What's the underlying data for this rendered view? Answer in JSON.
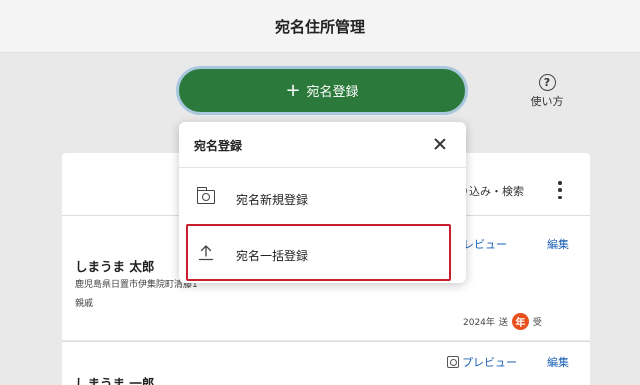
{
  "header": {
    "title": "宛名住所管理"
  },
  "register_button": {
    "plus": "+",
    "label": "宛名登録"
  },
  "help": {
    "icon_glyph": "?",
    "label": "使い方"
  },
  "toolbar": {
    "filter_label": "り込み・検索"
  },
  "dropdown": {
    "title": "宛名登録",
    "items": [
      {
        "label": "宛名新規登録",
        "icon": "folder-person-icon"
      },
      {
        "label": "宛名一括登録",
        "icon": "upload-icon"
      }
    ]
  },
  "entries": [
    {
      "name": "しまうま 太郎",
      "address": "鹿児島県日置市伊集院町清藤1",
      "relation": "親戚",
      "preview": "プレビュー",
      "edit": "編集",
      "status": {
        "year": "2024年",
        "sent": "送",
        "badge": "年",
        "received": "受"
      }
    },
    {
      "name": "しまうま 一郎",
      "preview": "プレビュー",
      "edit": "編集"
    }
  ],
  "colors": {
    "primary_green": "#2b7a3b",
    "link_blue": "#1a5fb4",
    "highlight_red": "#c8202e",
    "badge_orange": "#e8501e"
  }
}
